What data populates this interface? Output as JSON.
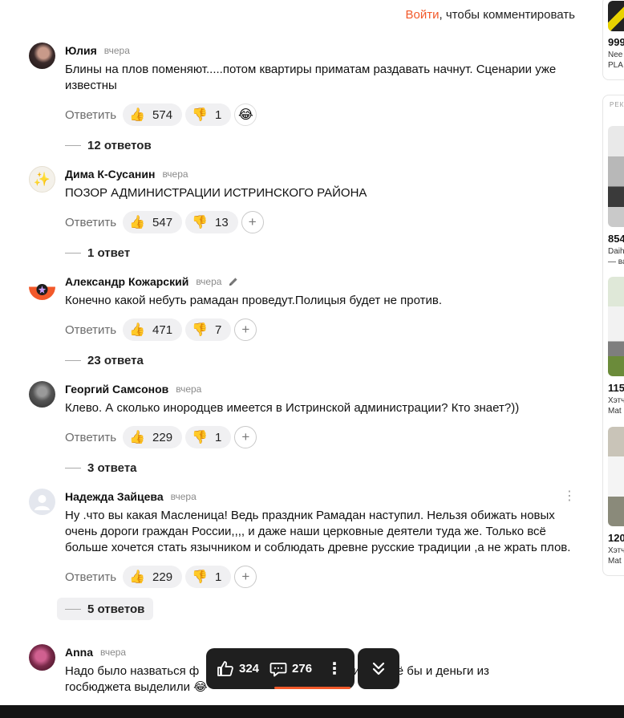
{
  "header": {
    "login_link": "Войти",
    "login_suffix": ", чтобы комментировать"
  },
  "reply_label": "Ответить",
  "comments": [
    {
      "author": "Юлия",
      "time": "вчера",
      "text": "Блины на плов поменяют.....потом квартиры приматам раздавать начнут. Сценарии уже известны",
      "likes": "574",
      "dislikes": "1",
      "replies": "12 ответов"
    },
    {
      "author": "Дима К-Сусанин",
      "time": "вчера",
      "text": "ПОЗОР АДМИНИСТРАЦИИ ИСТРИНСКОГО РАЙОНА",
      "likes": "547",
      "dislikes": "13",
      "replies": "1 ответ"
    },
    {
      "author": "Александр Кожарский",
      "time": "вчера",
      "text": "Конечно какой небуть рамадан проведут.Полицыя будет не против.",
      "likes": "471",
      "dislikes": "7",
      "replies": "23 ответа"
    },
    {
      "author": "Георгий Самсонов",
      "time": "вчера",
      "text": "Клево. А сколько инородцев имеется в Истринской администрации? Кто знает?))",
      "likes": "229",
      "dislikes": "1",
      "replies": "3 ответа"
    },
    {
      "author": "Надежда Зайцева",
      "time": "вчера",
      "text": "Ну .что вы какая Масленица! Ведь праздник Рамадан наступил. Нельзя обижать новых очень дороги граждан России,,,, и даже наши церковные деятели туда же. Только всё больше хочется стать язычником и соблюдать древне русские традиции ,а не жрать плов.",
      "likes": "229",
      "dislikes": "1",
      "replies": "5 ответов"
    },
    {
      "author": "Anna",
      "time": "вчера",
      "text_start": "Надо было назваться ф",
      "text_end": "шили, ещё бы и деньги из",
      "text_line2": "госбюджета выделили"
    }
  ],
  "floatbar": {
    "likes": "324",
    "comments": "276"
  },
  "sidebar": {
    "ad_label": "РЕКЛАМА",
    "top_price": "999",
    "top_text1": "Nee",
    "top_text2": "PLA",
    "items": [
      {
        "price": "854",
        "text1": "Daih",
        "text2": "— ва"
      },
      {
        "price": "115",
        "text1": "Хэтч",
        "text2": "Mat"
      },
      {
        "price": "120",
        "text1": "Хэтч",
        "text2": "Mat"
      }
    ]
  },
  "colors": {
    "accent": "#f2592a",
    "bar": "#1f1f1f"
  }
}
